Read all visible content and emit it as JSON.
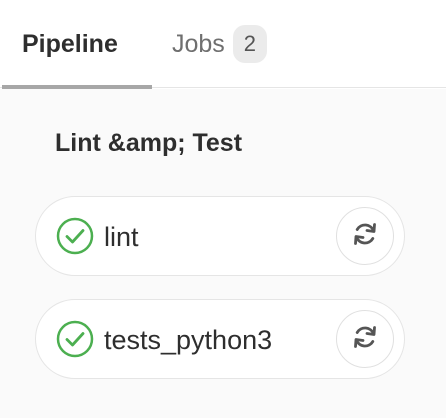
{
  "tabs": [
    {
      "label": "Pipeline",
      "active": true
    },
    {
      "label": "Jobs",
      "count": "2",
      "active": false
    }
  ],
  "stage": {
    "title": "Lint &amp; Test",
    "jobs": [
      {
        "name": "lint",
        "status": "success",
        "status_icon": "check-circle-icon",
        "action_icon": "retry-icon"
      },
      {
        "name": "tests_python3",
        "status": "success",
        "status_icon": "check-circle-icon",
        "action_icon": "retry-icon"
      }
    ]
  },
  "colors": {
    "success": "#4caf50",
    "text": "#2e2e2e",
    "muted": "#6f6f6f",
    "active_tab_underline": "#a7a7a7",
    "badge_bg": "#ebebeb",
    "stage_bg": "#fafafa",
    "icon_gray": "#555555"
  }
}
